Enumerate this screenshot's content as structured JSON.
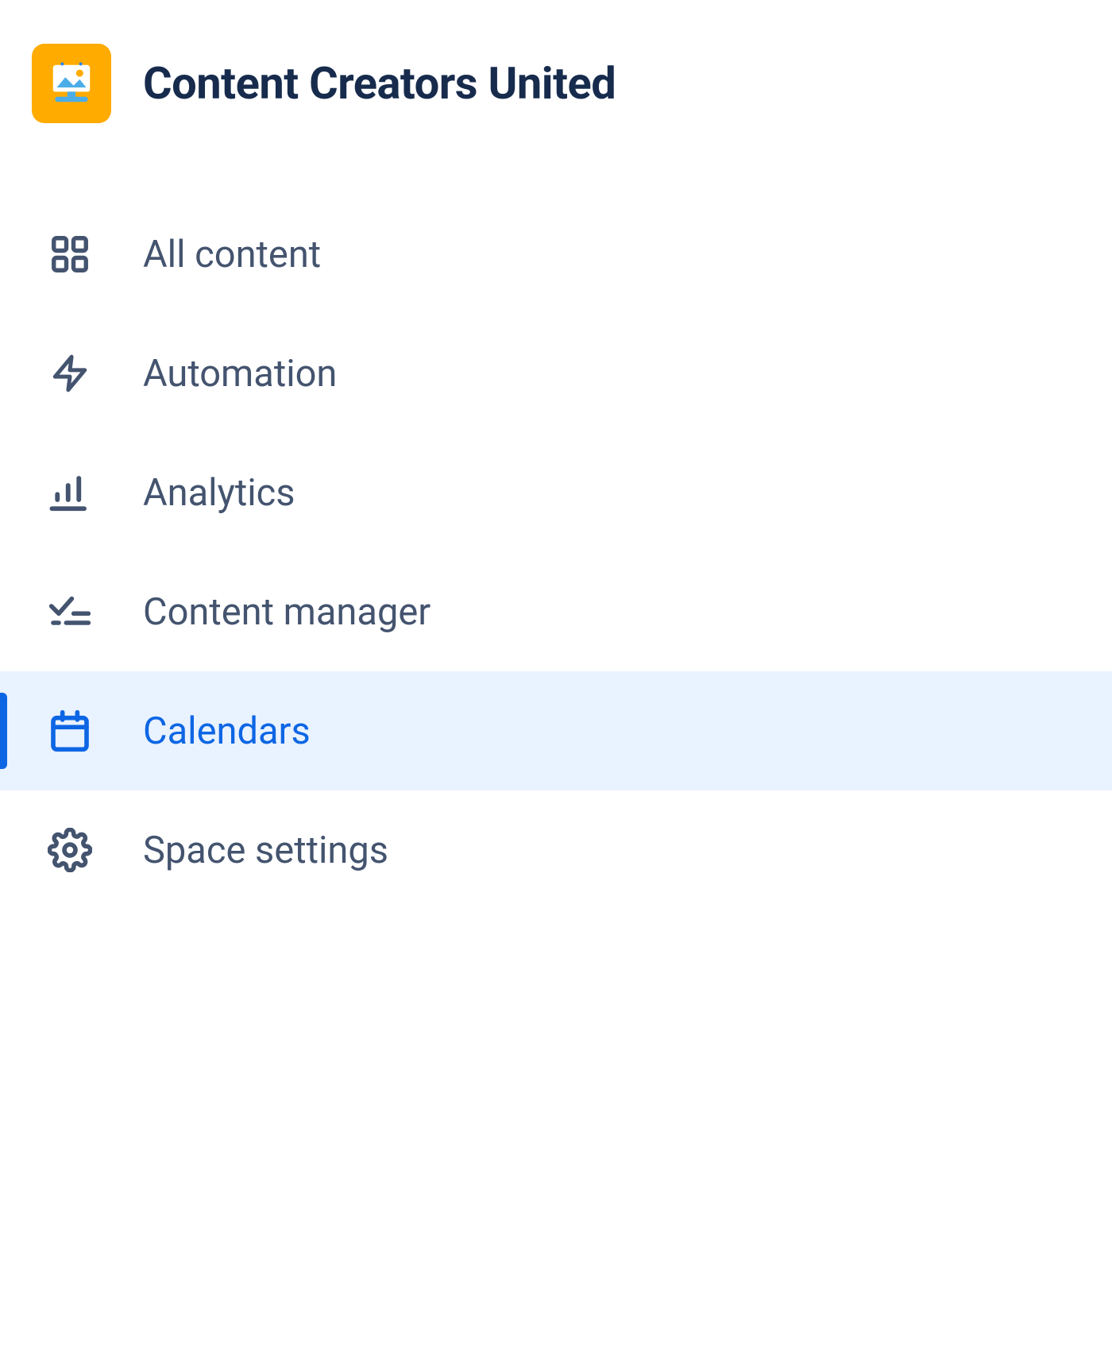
{
  "space": {
    "title": "Content Creators United",
    "icon": "easel-picture-icon"
  },
  "sidebar": {
    "items": [
      {
        "label": "All content",
        "icon": "grid-icon",
        "active": false
      },
      {
        "label": "Automation",
        "icon": "lightning-icon",
        "active": false
      },
      {
        "label": "Analytics",
        "icon": "bar-chart-icon",
        "active": false
      },
      {
        "label": "Content manager",
        "icon": "checklist-icon",
        "active": false
      },
      {
        "label": "Calendars",
        "icon": "calendar-icon",
        "active": true
      },
      {
        "label": "Space settings",
        "icon": "gear-icon",
        "active": false
      }
    ]
  },
  "colors": {
    "accent": "#0C66E4",
    "accentBg": "#E9F2FF",
    "text": "#44546F",
    "titleText": "#172B4D",
    "spaceIconBg": "#FFAB00"
  }
}
